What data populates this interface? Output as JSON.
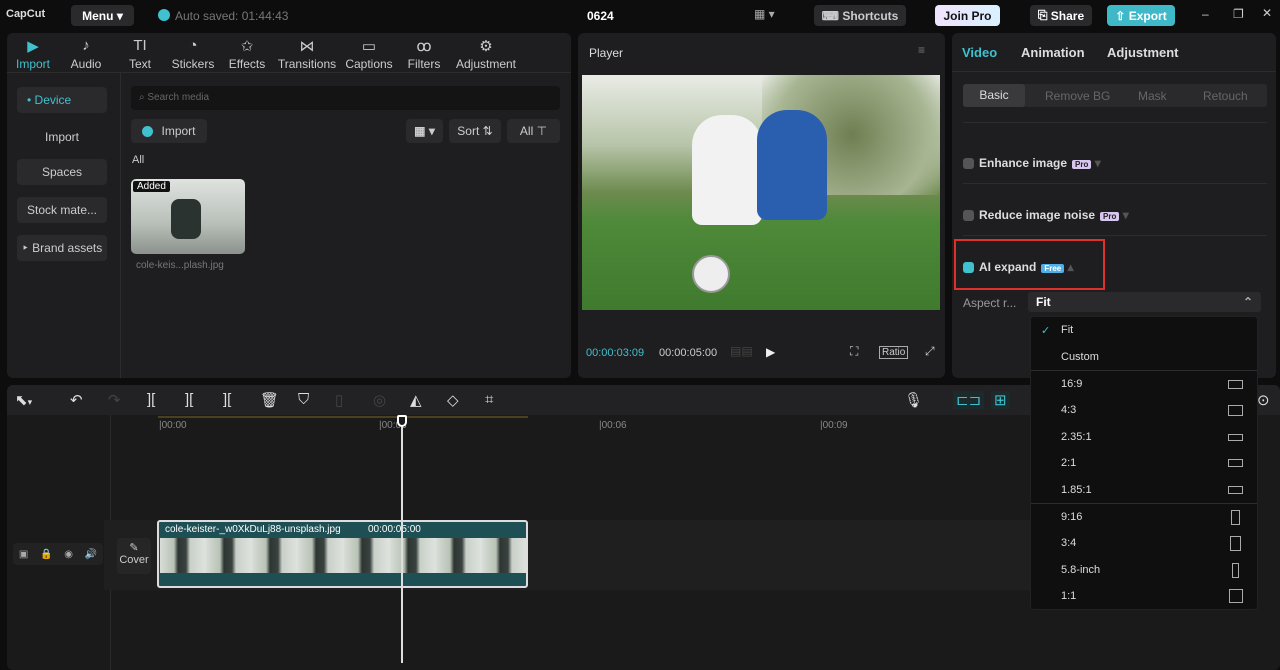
{
  "app": {
    "logo": "CapCut",
    "menu": "Menu",
    "autosave": "Auto saved: 01:44:43",
    "project": "0624",
    "shortcuts": "Shortcuts",
    "join_pro": "Join Pro",
    "share": "Share",
    "export": "Export"
  },
  "tools": [
    {
      "label": "Import",
      "icon": "▶"
    },
    {
      "label": "Audio",
      "icon": "♪"
    },
    {
      "label": "Text",
      "icon": "TI"
    },
    {
      "label": "Stickers",
      "icon": "◔"
    },
    {
      "label": "Effects",
      "icon": "✩"
    },
    {
      "label": "Transitions",
      "icon": "⋈"
    },
    {
      "label": "Captions",
      "icon": "▭"
    },
    {
      "label": "Filters",
      "icon": "ꝏ"
    },
    {
      "label": "Adjustment",
      "icon": "⚙"
    }
  ],
  "sidebar": [
    "• Device",
    "Import",
    "Spaces",
    "Stock mate...",
    "‣ Brand assets"
  ],
  "media": {
    "search_placeholder": "Search media",
    "import": "Import",
    "sort": "Sort",
    "all_filter": "All",
    "section": "All",
    "item": {
      "badge": "Added",
      "name": "cole-keis...plash.jpg"
    }
  },
  "player": {
    "title": "Player",
    "current": "00:00:03:09",
    "total": "00:00:05:00",
    "ratio": "Ratio"
  },
  "right": {
    "tabs": [
      "Video",
      "Animation",
      "Adjustment"
    ],
    "subtabs": [
      "Basic",
      "Remove BG",
      "Mask",
      "Retouch"
    ],
    "enhance": "Enhance image",
    "reduce": "Reduce image noise",
    "pro_badge": "Pro",
    "ai_expand": "AI expand",
    "free_badge": "Free",
    "aspect_label": "Aspect r...",
    "aspect_value": "Fit"
  },
  "dropdown": [
    {
      "label": "Fit",
      "checked": true
    },
    {
      "label": "Custom"
    },
    {
      "label": "16:9"
    },
    {
      "label": "4:3"
    },
    {
      "label": "2.35:1"
    },
    {
      "label": "2:1"
    },
    {
      "label": "1.85:1"
    },
    {
      "label": "9:16"
    },
    {
      "label": "3:4"
    },
    {
      "label": "5.8-inch"
    },
    {
      "label": "1:1"
    }
  ],
  "timeline": {
    "ticks": [
      "|00:00",
      "|00:03",
      "|00:06",
      "|00:09"
    ],
    "clip_name": "cole-keister-_w0XkDuLj88-unsplash.jpg",
    "clip_duration": "00:00:05:00",
    "cover": "Cover"
  },
  "colors": {
    "accent": "#3fc1cf",
    "highlight": "#e0302a"
  }
}
